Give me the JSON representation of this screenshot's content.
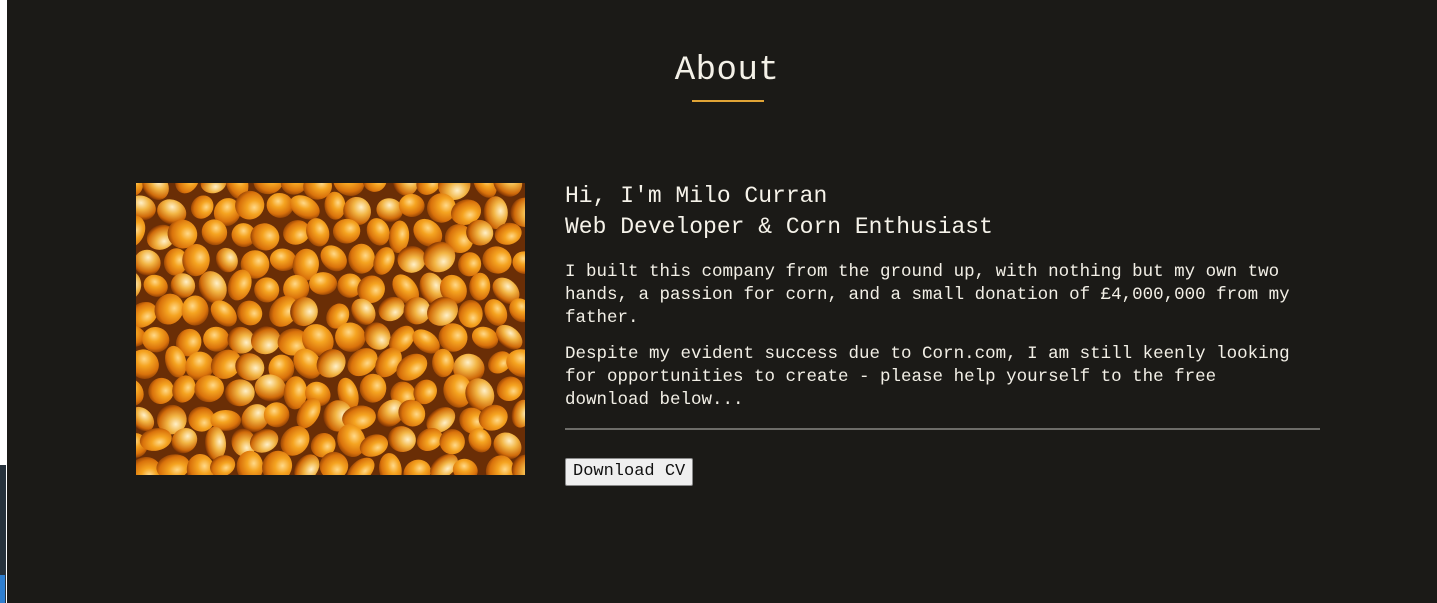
{
  "about": {
    "title": "About",
    "intro_line1": "Hi, I'm Milo Curran",
    "intro_line2": "Web Developer & Corn Enthusiast",
    "paragraph1": "I built this company from the ground up, with nothing but my own two hands, a passion for corn, and a small donation of £4,000,000 from my father.",
    "paragraph2": "Despite my evident success due to Corn.com, I am still keenly looking for opportunities to create - please help yourself to the free download below...",
    "download_label": "Download CV",
    "image_subject": "corn kernels photo"
  },
  "colors": {
    "background": "#1b1a17",
    "accent": "#e0a436",
    "text": "#f2efe6",
    "divider": "#6d6c68"
  }
}
